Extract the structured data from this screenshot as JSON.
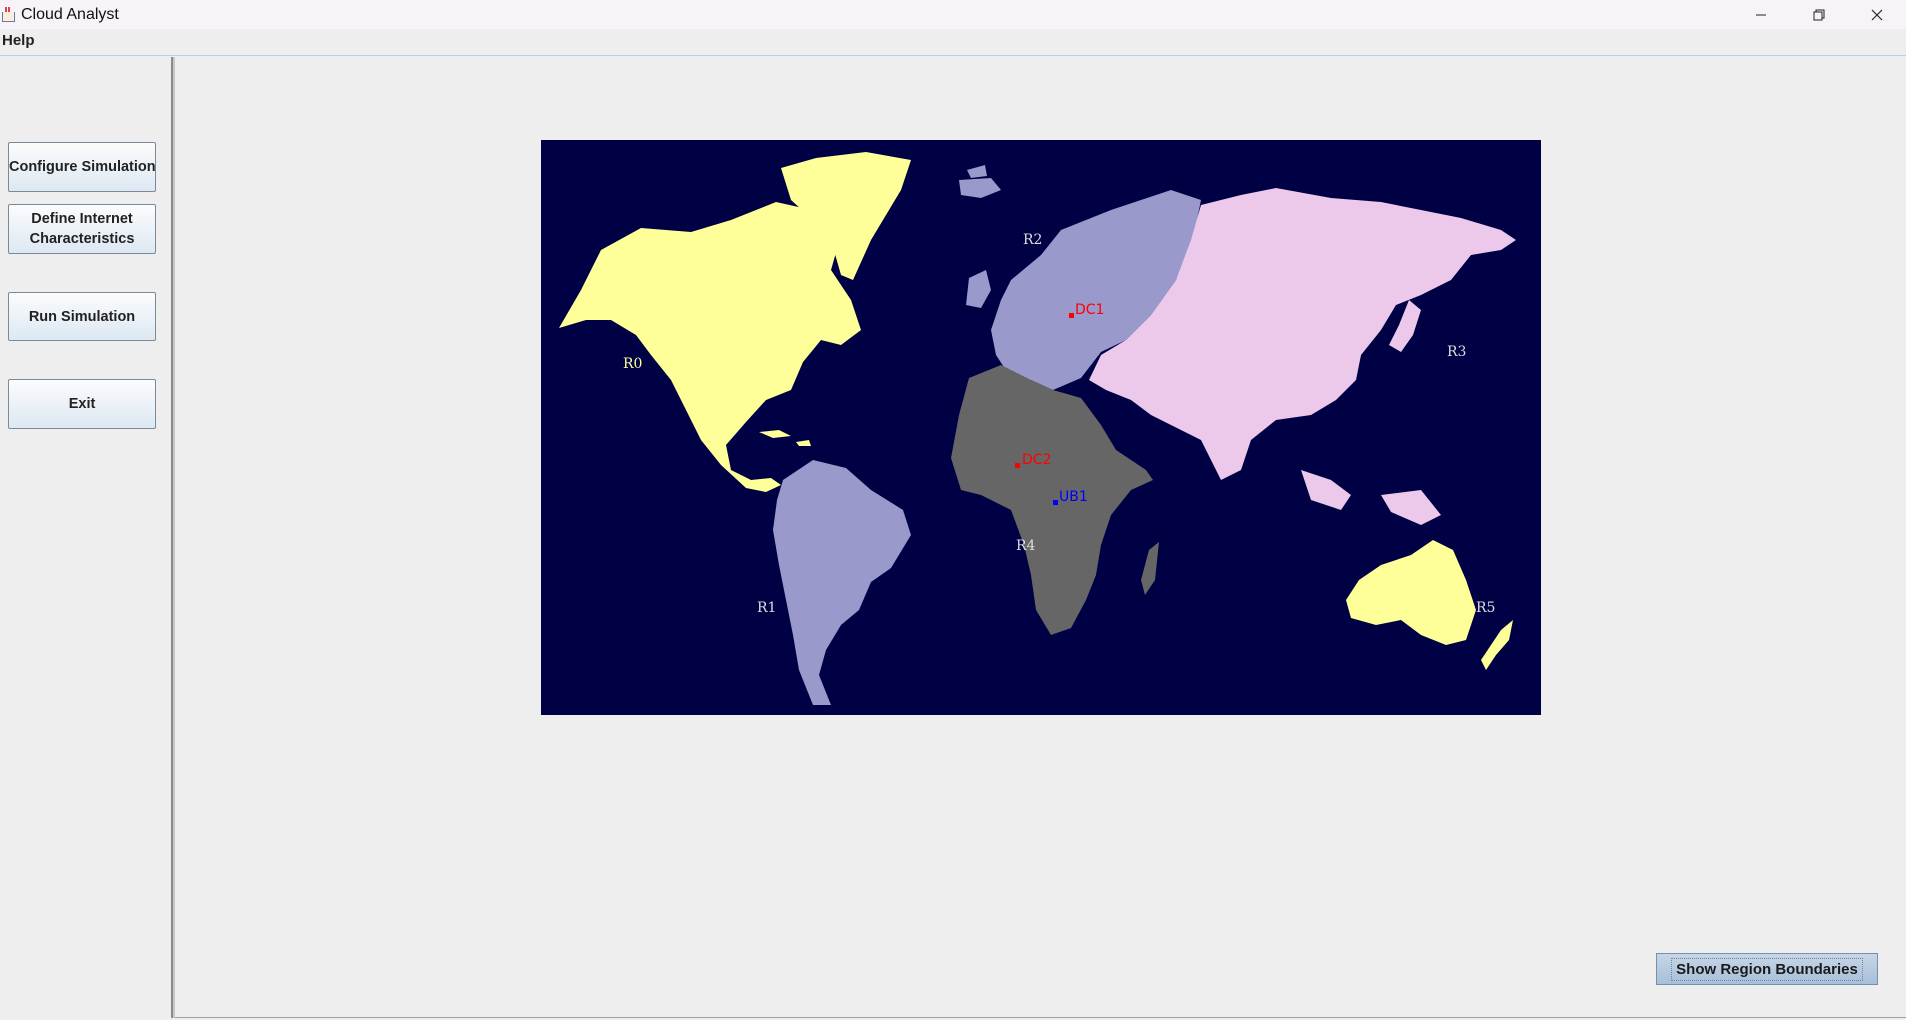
{
  "window": {
    "title": "Cloud Analyst",
    "app_icon": "java-cup-icon",
    "controls": [
      "minimize-icon",
      "restore-icon",
      "close-icon"
    ]
  },
  "menu": {
    "items": [
      "Help"
    ]
  },
  "sidebar": {
    "configure_label": "Configure Simulation",
    "define_label": "Define Internet\nCharacteristics",
    "run_label": "Run Simulation",
    "exit_label": "Exit"
  },
  "map": {
    "colors": {
      "ocean": "#000045",
      "r0": "#ffff99",
      "r1": "#9999cc",
      "r2": "#9999cc",
      "r3": "#ecc8ea",
      "r4": "#666666",
      "r5": "#ffff99",
      "datacenter": "#ff0000",
      "userbase": "#0000ff"
    },
    "region_labels": {
      "r0": "R0",
      "r1": "R1",
      "r2": "R2",
      "r3": "R3",
      "r4": "R4",
      "r5": "R5"
    },
    "markers": {
      "dc1": "DC1",
      "dc2": "DC2",
      "ub1": "UB1"
    }
  },
  "buttons": {
    "show_regions_label": "Show Region Boundaries"
  }
}
